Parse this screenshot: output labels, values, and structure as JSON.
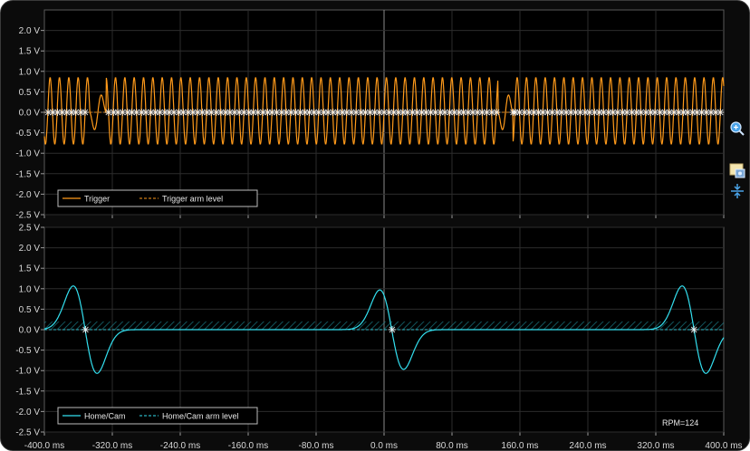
{
  "chart_data": [
    {
      "type": "line",
      "series": [
        {
          "name": "Trigger",
          "color": "#ff9a1a",
          "style": "solid"
        },
        {
          "name": "Trigger arm level",
          "color": "#ff9a1a",
          "style": "dashed"
        }
      ],
      "ylim": [
        -2.5,
        2.5
      ],
      "yticks": [
        "2.0 V",
        "1.5 V",
        "1.0 V",
        "0.5 V",
        "0.0 V",
        "-0.5 V",
        "-1.0 V",
        "-1.5 V",
        "-2.0 V",
        "-2.5 V"
      ],
      "ytick_values": [
        2.0,
        1.5,
        1.0,
        0.5,
        0.0,
        -0.5,
        -1.0,
        -1.5,
        -2.0,
        -2.5
      ],
      "xlim": [
        -400,
        400
      ],
      "grid": true,
      "legend": "bottom-left",
      "signal": {
        "amplitude_pos": 0.85,
        "amplitude_neg": -0.78,
        "period_ms": 11.0,
        "gaps_ms": [
          [
            -347,
            -327
          ],
          [
            134,
            152
          ]
        ]
      }
    },
    {
      "type": "line",
      "series": [
        {
          "name": "Home/Cam",
          "color": "#33e0f0",
          "style": "solid"
        },
        {
          "name": "Home/Cam arm level",
          "color": "#33e0f0",
          "style": "dashed"
        }
      ],
      "ylim": [
        -2.5,
        2.5
      ],
      "yticks": [
        "2.5 V",
        "2.0 V",
        "1.5 V",
        "1.0 V",
        "0.5 V",
        "0.0 V",
        "-0.5 V",
        "-1.0 V",
        "-1.5 V",
        "-2.0 V",
        "-2.5 V"
      ],
      "ytick_values": [
        2.5,
        2.0,
        1.5,
        1.0,
        0.5,
        0.0,
        -0.5,
        -1.0,
        -1.5,
        -2.0,
        -2.5
      ],
      "xlim": [
        -400,
        400
      ],
      "xticks": [
        "-400.0 ms",
        "-320.0 ms",
        "-240.0 ms",
        "-160.0 ms",
        "-80.0 ms",
        "0.0 ms",
        "80.0 ms",
        "160.0 ms",
        "240.0 ms",
        "320.0 ms",
        "400.0 ms"
      ],
      "xtick_values": [
        -400,
        -320,
        -240,
        -160,
        -80,
        0,
        80,
        160,
        240,
        320,
        400
      ],
      "grid": true,
      "legend": "bottom-left",
      "pulses": [
        {
          "center_ms": -352,
          "peak": 1.1,
          "trough": -1.1
        },
        {
          "center_ms": 9,
          "peak": 1.0,
          "trough": -0.95
        },
        {
          "center_ms": 365,
          "peak": 1.1,
          "trough": -0.65
        }
      ]
    }
  ],
  "annotation": {
    "rpm": "RPM=124"
  },
  "tools": {
    "zoom_icon": "zoom-icon",
    "snapshot_icon": "snapshot-icon",
    "scale_icon": "vertical-scale-icon"
  }
}
